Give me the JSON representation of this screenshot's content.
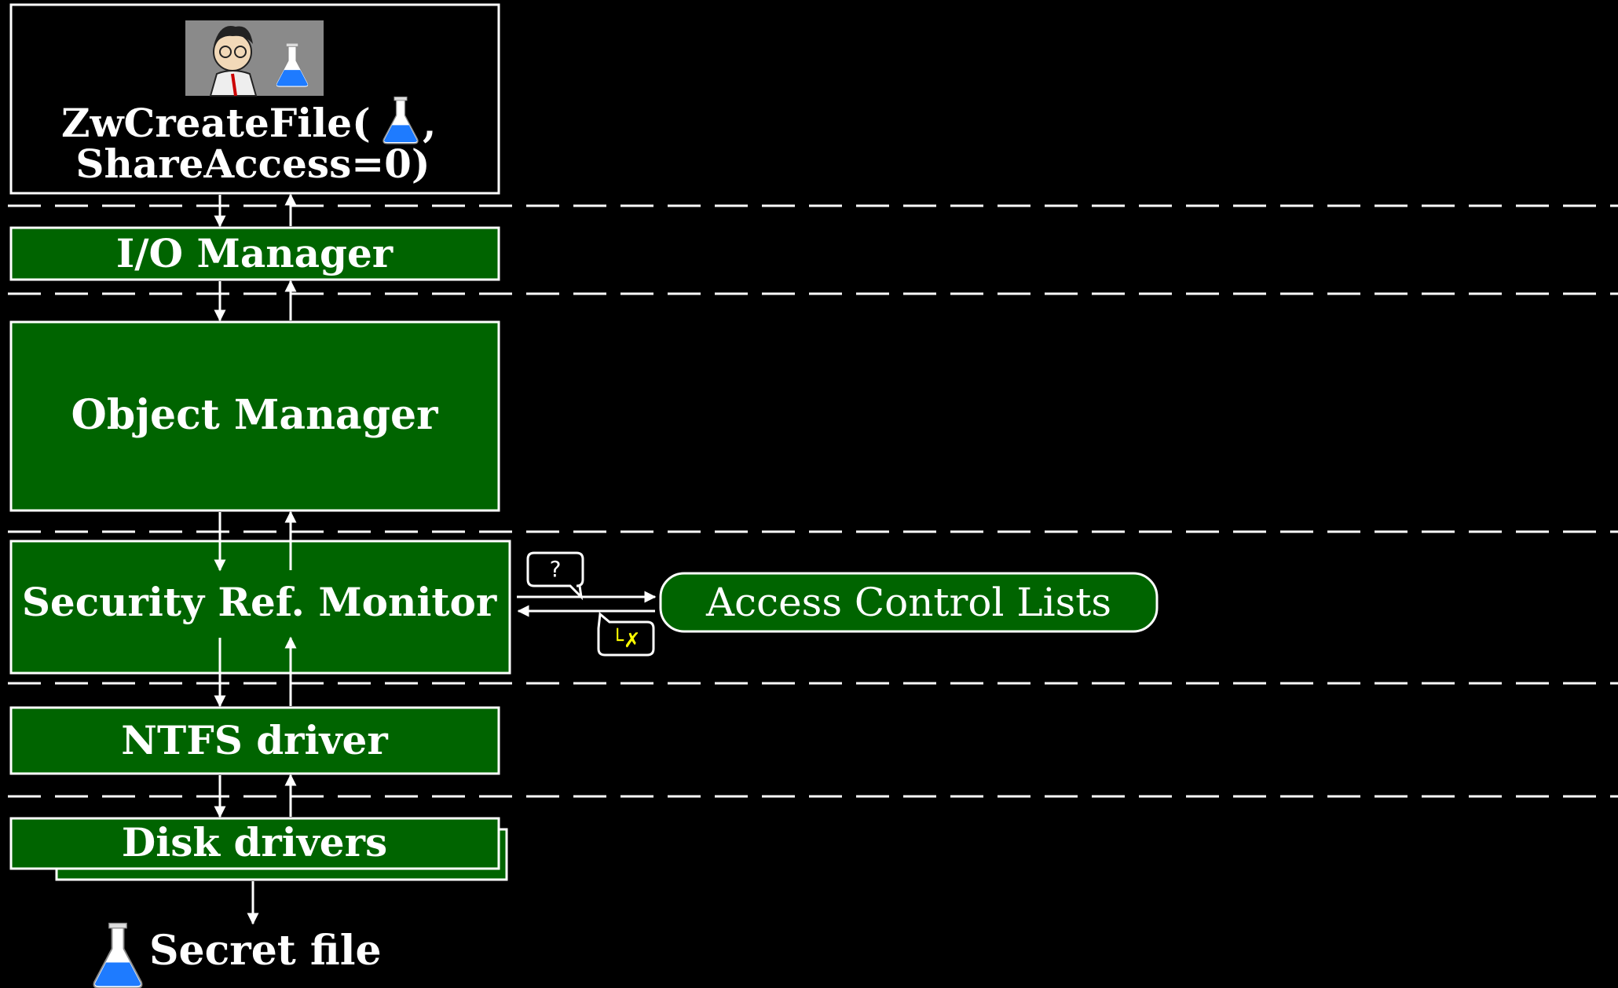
{
  "caller": {
    "call_line1_before": "ZwCreateFile(",
    "call_line1_after": ",",
    "call_line2": "ShareAccess=0)"
  },
  "layers": {
    "io_manager": "I/O Manager",
    "object_manager": "Object Manager",
    "security_ref_monitor": "Security Ref. Monitor",
    "ntfs_driver": "NTFS driver",
    "disk_drivers": "Disk drivers"
  },
  "acl": {
    "label": "Access Control Lists",
    "query_bubble": "?",
    "reply_bubble": "└✗"
  },
  "target": {
    "label": "Secret file"
  },
  "colors": {
    "background": "#000000",
    "layer_fill": "#006400",
    "flask": "#1e7bff",
    "reply_mark": "#ffff00"
  },
  "icons": [
    "person-holding-flask-icon",
    "flask-icon"
  ]
}
